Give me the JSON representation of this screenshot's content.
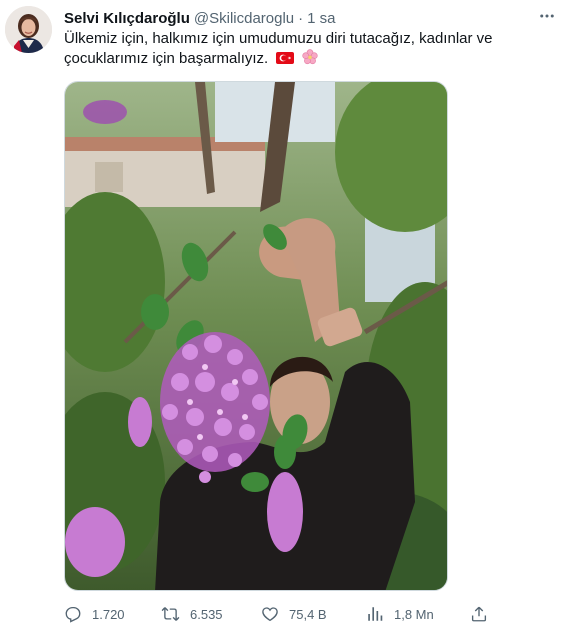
{
  "tweet": {
    "author_name": "Selvi Kılıçdaroğlu",
    "handle": "@Skilicdaroglu",
    "separator": "·",
    "time": "1 sa",
    "text": "Ülkemiz için, halkımız için umudumuzu diri tutacağız, kadınlar ve çocuklarımız için başarmalıyız.",
    "emojis": [
      "turkey-flag",
      "cherry-blossom"
    ],
    "colors": {
      "text": "#0f1419",
      "muted": "#536471",
      "flag": "#e30a17"
    }
  },
  "actions": {
    "replies": "1.720",
    "reposts": "6.535",
    "likes": "75,4 B",
    "views": "1,8 Mn"
  }
}
